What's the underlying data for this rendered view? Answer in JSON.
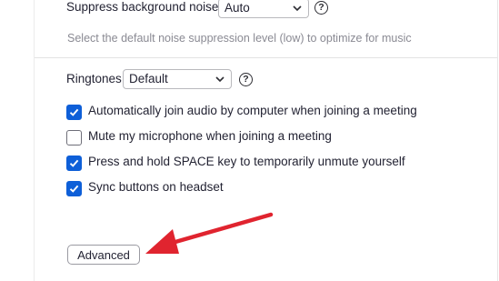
{
  "noise": {
    "label": "Suppress background noise",
    "select_value": "Auto",
    "hint": "Select the default noise suppression level (low) to optimize for music"
  },
  "ringtones": {
    "label": "Ringtones",
    "select_value": "Default"
  },
  "help_glyph": "?",
  "options": [
    {
      "label": "Automatically join audio by computer when joining a meeting",
      "checked": true
    },
    {
      "label": "Mute my microphone when joining a meeting",
      "checked": false
    },
    {
      "label": "Press and hold SPACE key to temporarily unmute yourself",
      "checked": true
    },
    {
      "label": "Sync buttons on headset",
      "checked": true
    }
  ],
  "advanced_button": "Advanced",
  "colors": {
    "accent": "#0e5fd8",
    "annotation_arrow": "#e0242f"
  },
  "icons": {
    "chevron": "chevron-down-icon",
    "help": "help-circle-icon",
    "check": "check-icon"
  }
}
